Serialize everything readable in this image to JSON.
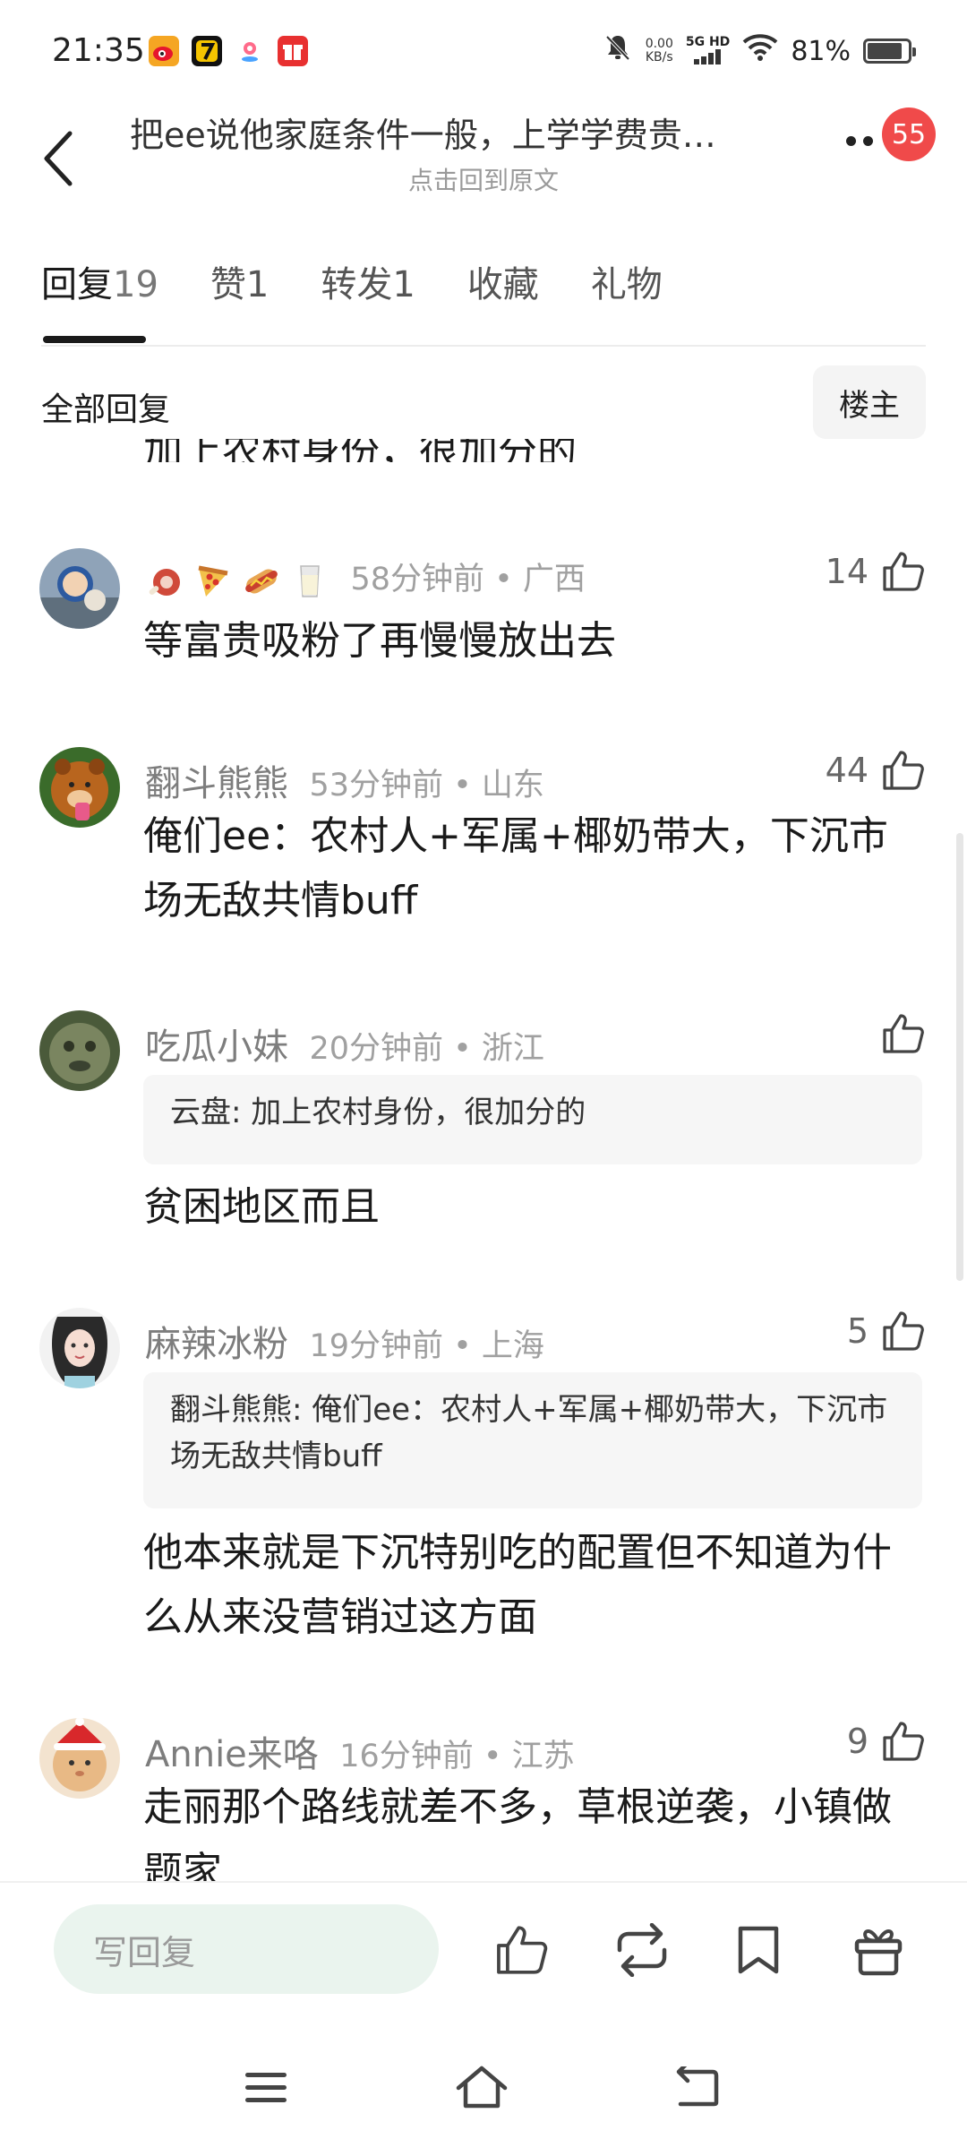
{
  "status_bar": {
    "time": "21:35",
    "net_speed": "0.00",
    "net_unit": "KB/s",
    "signal_label": "5G HD",
    "battery": "81%",
    "apps": [
      "weibo-app-icon",
      "qq-app-icon",
      "map-app-icon",
      "gift-app-icon"
    ]
  },
  "header": {
    "title": "把ee说他家庭条件一般，上学学费贵…",
    "subtitle": "点击回到原文",
    "badge": "55"
  },
  "tabs": [
    {
      "label": "回复",
      "count": "19"
    },
    {
      "label": "赞",
      "count": "1"
    },
    {
      "label": "转发",
      "count": "1"
    },
    {
      "label": "收藏",
      "count": ""
    },
    {
      "label": "礼物",
      "count": ""
    }
  ],
  "section": {
    "title": "全部回复",
    "filter": "楼主"
  },
  "partial_text": "加上农村身份，很加分的",
  "comments": [
    {
      "name": "",
      "name_emojis": [
        "meat-emoji",
        "pizza-emoji",
        "hotdog-emoji",
        "milk-emoji"
      ],
      "time": "58分钟前 • 广西",
      "likes": "14",
      "text": "等富贵吸粉了再慢慢放出去"
    },
    {
      "name": "翻斗熊熊",
      "time": "53分钟前 • 山东",
      "likes": "44",
      "text": "俺们ee：农村人+军属+椰奶带大，下沉市场无敌共情buff"
    },
    {
      "name": "吃瓜小妹",
      "time": "20分钟前 • 浙江",
      "likes": "",
      "quote": "云盘: 加上农村身份，很加分的",
      "text": "贫困地区而且"
    },
    {
      "name": "麻辣冰粉",
      "time": "19分钟前 • 上海",
      "likes": "5",
      "quote": "翻斗熊熊: 俺们ee：农村人+军属+椰奶带大，下沉市场无敌共情buff",
      "text": "他本来就是下沉特别吃的配置但不知道为什么从来没营销过这方面"
    },
    {
      "name": "Annie来咯",
      "time": "16分钟前 • 江苏",
      "likes": "9",
      "text": "走丽那个路线就差不多，草根逆袭，小镇做题家"
    }
  ],
  "bottom_bar": {
    "reply_placeholder": "写回复"
  },
  "colors": {
    "badge": "#f04a4a",
    "reply_input_bg": "#eaf4ee",
    "quote_bg": "#f6f6f6"
  }
}
